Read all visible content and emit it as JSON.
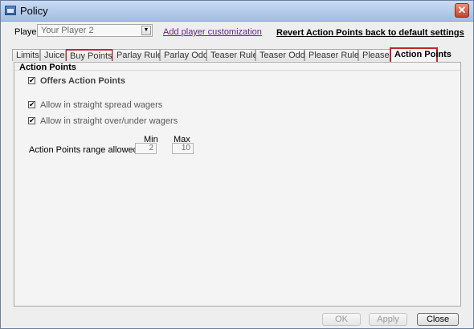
{
  "window": {
    "title": "Policy",
    "close_glyph": "✕"
  },
  "header": {
    "player_label": "Player",
    "player_value": "Your Player 2",
    "customize_link": "Add player customization",
    "revert_link": "Revert Action Points back to default settings"
  },
  "tabs": [
    {
      "label": "Limits",
      "state": "normal"
    },
    {
      "label": "Juice",
      "state": "normal"
    },
    {
      "label": "Buy Points",
      "state": "highlighted"
    },
    {
      "label": "Parlay Rules",
      "state": "normal"
    },
    {
      "label": "Parlay Odds",
      "state": "normal"
    },
    {
      "label": "Teaser Rules",
      "state": "normal"
    },
    {
      "label": "Teaser Odds",
      "state": "normal"
    },
    {
      "label": "Pleaser Rules",
      "state": "normal"
    },
    {
      "label": "Pleaser Odds",
      "state": "normal"
    },
    {
      "label": "Action Points",
      "state": "active"
    }
  ],
  "panel": {
    "section_title": "Action Points",
    "offers_label": "Offers Action Points",
    "offers_checked": true,
    "spread_label": "Allow in straight spread wagers",
    "spread_checked": true,
    "overunder_label": "Allow in straight over/under wagers",
    "overunder_checked": true,
    "range_label": "Action Points range allowed:",
    "min_label": "Min",
    "max_label": "Max",
    "min_value": "2",
    "max_value": "10"
  },
  "buttons": {
    "ok": "OK",
    "apply": "Apply",
    "close": "Close"
  },
  "colors": {
    "accent_tab_border": "#c0272d",
    "titlebar": "#a3bde1",
    "link": "#6b1f8f"
  },
  "icons": {
    "app": "policy-window-icon",
    "close": "close-icon",
    "dropdown": "chevron-down-icon",
    "check": "checkmark-icon"
  }
}
